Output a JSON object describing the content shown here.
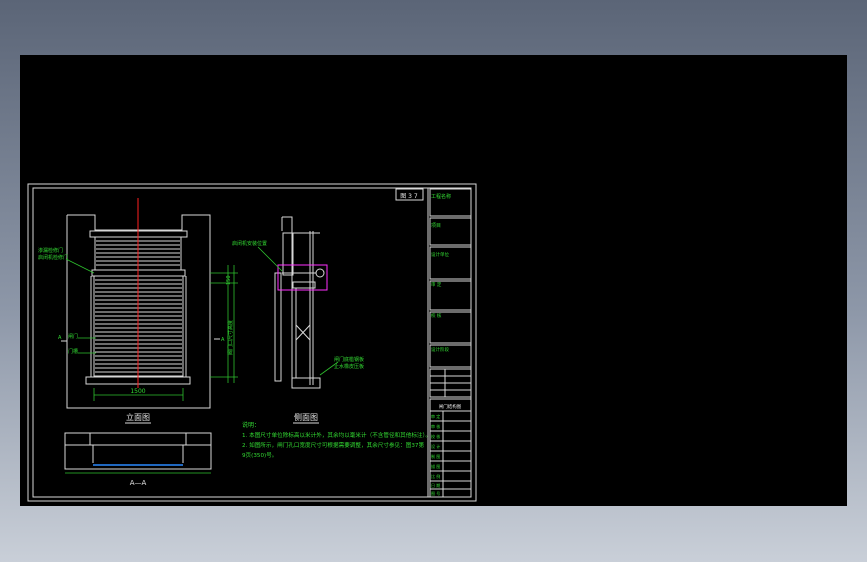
{
  "viewport": {
    "background": "#000000"
  },
  "sheet": {
    "number_box": "图 3 7",
    "views": {
      "front": "立面图",
      "side": "侧面图",
      "section": "A—A"
    },
    "dimensions": {
      "front_width": "1500",
      "side_top": "150",
      "side_height": "阀门口尺寸高度"
    },
    "labels": {
      "top_left_1": "渗漏检修门",
      "top_left_2": "启闭机检修门",
      "left_1": "A",
      "left_2": "闸门",
      "left_3": "门槽",
      "side_top": "启闭机安装位置",
      "side_bottom_1": "闸门底槛钢板",
      "side_bottom_2": "止水橡皮压板"
    },
    "notes": {
      "heading": "说明：",
      "line1": "1. 本图尺寸单位除标高以米计外，其余均以毫米计（不含管径和其他标注）。",
      "line2": "2. 如图所示，闸门孔口宽度尺寸可根据需要调整，其余尺寸参见：图37第",
      "line3": "9页(350)号。"
    },
    "title_block": {
      "cells": [
        "工程名称",
        "项目",
        "设计单位",
        "审 定",
        "校 核",
        "设计阶段"
      ],
      "table_header": "闸门结构图",
      "grid_labels": [
        "审 定",
        "审 核",
        "校 核",
        "设 计",
        "制 图",
        "描 图",
        "比 例",
        "日 期",
        "图 号"
      ]
    }
  },
  "colors": {
    "line_white": "#d8d8d8",
    "line_green": "#2ec02e",
    "text_green": "#33dd33",
    "centerline_red": "#ff2020",
    "highlight_magenta": "#ff30ff"
  }
}
